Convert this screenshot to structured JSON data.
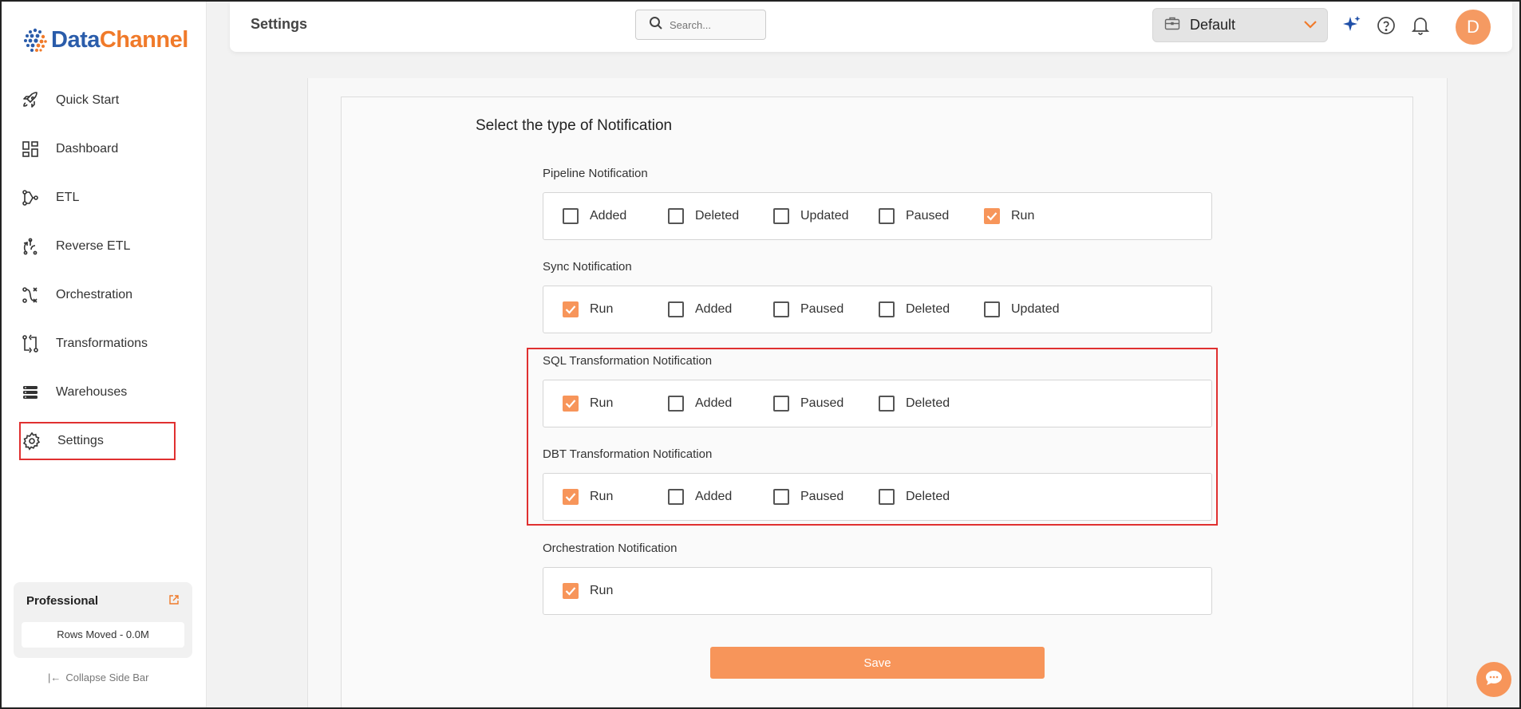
{
  "brand": {
    "name_part1": "Data",
    "name_part2": "Channel",
    "primary": "#2a5caa",
    "accent": "#f07a2a"
  },
  "sidebar": {
    "items": [
      {
        "label": "Quick Start",
        "icon": "rocket-icon"
      },
      {
        "label": "Dashboard",
        "icon": "dashboard-icon"
      },
      {
        "label": "ETL",
        "icon": "etl-icon"
      },
      {
        "label": "Reverse ETL",
        "icon": "reverse-etl-icon"
      },
      {
        "label": "Orchestration",
        "icon": "orchestration-icon"
      },
      {
        "label": "Transformations",
        "icon": "transformations-icon"
      },
      {
        "label": "Warehouses",
        "icon": "warehouses-icon"
      },
      {
        "label": "Settings",
        "icon": "gear-icon",
        "active": true
      }
    ],
    "plan": {
      "title": "Professional",
      "rows_moved": "Rows Moved - 0.0M"
    },
    "collapse_label": "Collapse Side Bar"
  },
  "header": {
    "title": "Settings",
    "search_placeholder": "Search...",
    "workspace": "Default",
    "avatar_initial": "D"
  },
  "content": {
    "section_title": "Select the type of Notification",
    "groups": [
      {
        "label": "Pipeline Notification",
        "options": [
          {
            "label": "Added",
            "checked": false
          },
          {
            "label": "Deleted",
            "checked": false
          },
          {
            "label": "Updated",
            "checked": false
          },
          {
            "label": "Paused",
            "checked": false
          },
          {
            "label": "Run",
            "checked": true
          }
        ]
      },
      {
        "label": "Sync Notification",
        "options": [
          {
            "label": "Run",
            "checked": true
          },
          {
            "label": "Added",
            "checked": false
          },
          {
            "label": "Paused",
            "checked": false
          },
          {
            "label": "Deleted",
            "checked": false
          },
          {
            "label": "Updated",
            "checked": false
          }
        ]
      },
      {
        "label": "SQL Transformation Notification",
        "options": [
          {
            "label": "Run",
            "checked": true
          },
          {
            "label": "Added",
            "checked": false
          },
          {
            "label": "Paused",
            "checked": false
          },
          {
            "label": "Deleted",
            "checked": false
          }
        ]
      },
      {
        "label": "DBT Transformation Notification",
        "options": [
          {
            "label": "Run",
            "checked": true
          },
          {
            "label": "Added",
            "checked": false
          },
          {
            "label": "Paused",
            "checked": false
          },
          {
            "label": "Deleted",
            "checked": false
          }
        ]
      },
      {
        "label": "Orchestration Notification",
        "options": [
          {
            "label": "Run",
            "checked": true
          }
        ]
      }
    ],
    "save_label": "Save"
  },
  "colors": {
    "checkbox_checked": "#f7955a",
    "highlight": "#e03030"
  }
}
